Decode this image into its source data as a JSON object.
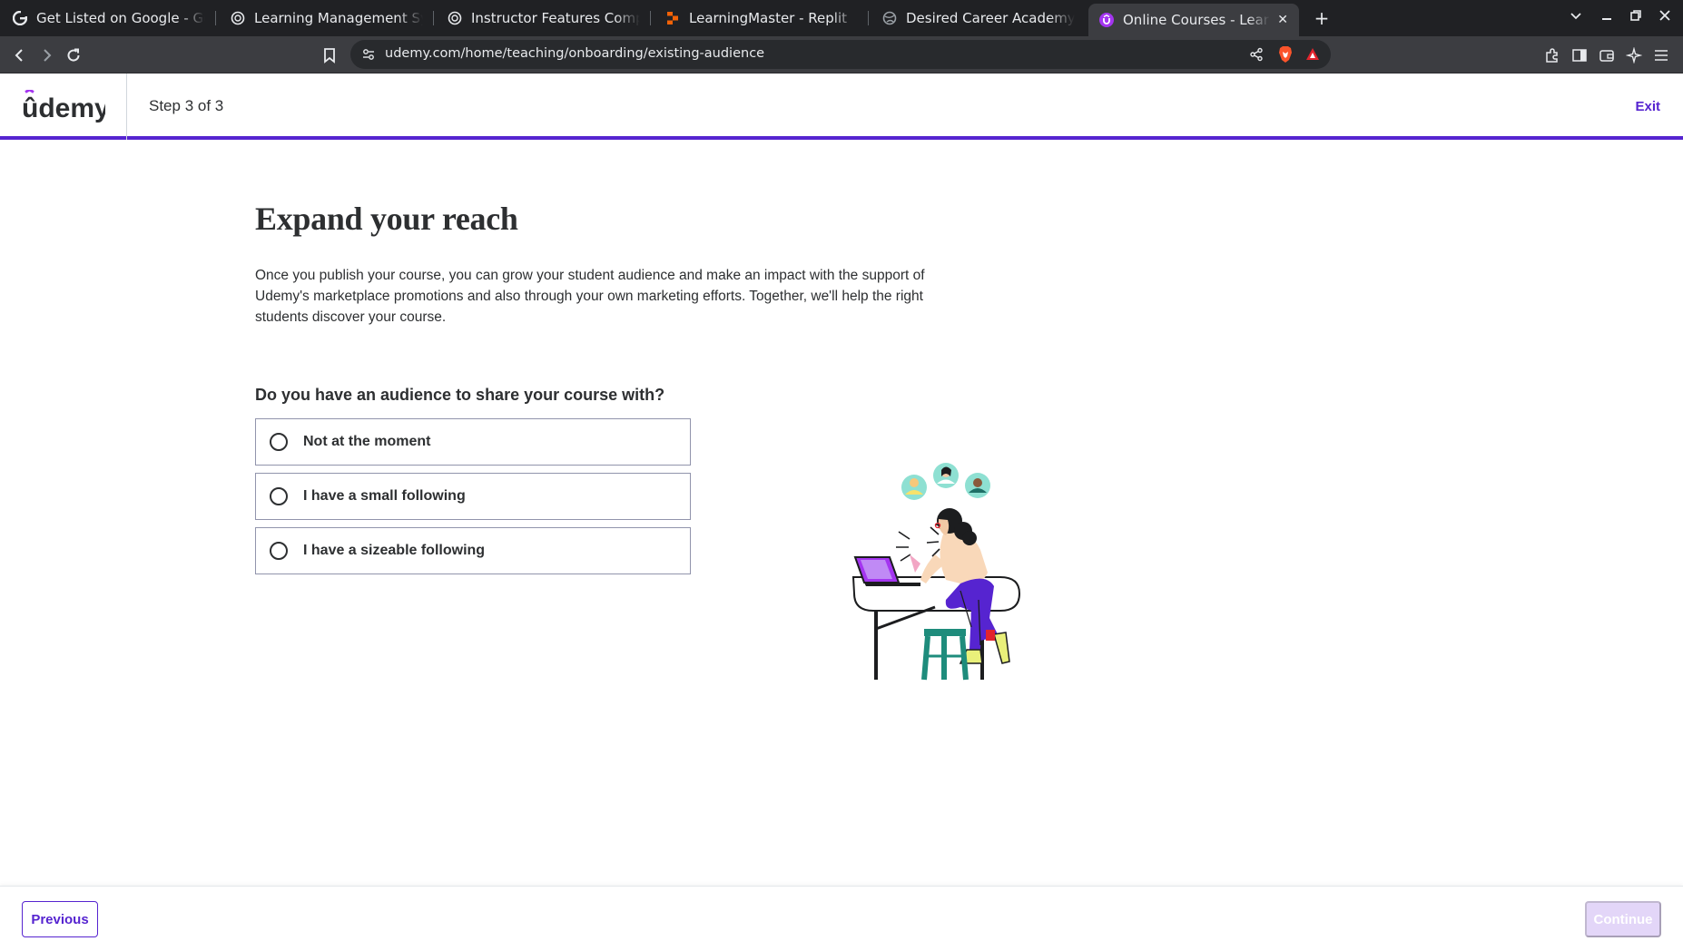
{
  "browser": {
    "tabs": [
      {
        "title": "Get Listed on Google - Goog",
        "icon": "google-icon"
      },
      {
        "title": "Learning Management Syste",
        "icon": "chatgpt-icon"
      },
      {
        "title": "Instructor Features Compari",
        "icon": "chatgpt-icon"
      },
      {
        "title": "LearningMaster - Replit",
        "icon": "replit-icon"
      },
      {
        "title": "Desired Career Academy | Er",
        "icon": "globe-icon"
      },
      {
        "title": "Online Courses - Learn A",
        "icon": "udemy-icon",
        "active": true
      }
    ],
    "url": "udemy.com/home/teaching/onboarding/existing-audience"
  },
  "header": {
    "logo": "ûdemy",
    "step": "Step 3 of 3",
    "exit": "Exit"
  },
  "main": {
    "title": "Expand your reach",
    "description": "Once you publish your course, you can grow your student audience and make an impact with the support of Udemy's marketplace promotions and also through your own marketing efforts. Together, we'll help the right students discover your course.",
    "question": "Do you have an audience to share your course with?",
    "options": [
      {
        "label": "Not at the moment",
        "selected": false
      },
      {
        "label": "I have a small following",
        "selected": false
      },
      {
        "label": "I have a sizeable following",
        "selected": false
      }
    ]
  },
  "footer": {
    "previous": "Previous",
    "continue": "Continue",
    "continue_disabled": true
  },
  "colors": {
    "brand": "#5624d0",
    "disabled_button": "#e3d6f8",
    "text": "#2d2f31"
  }
}
